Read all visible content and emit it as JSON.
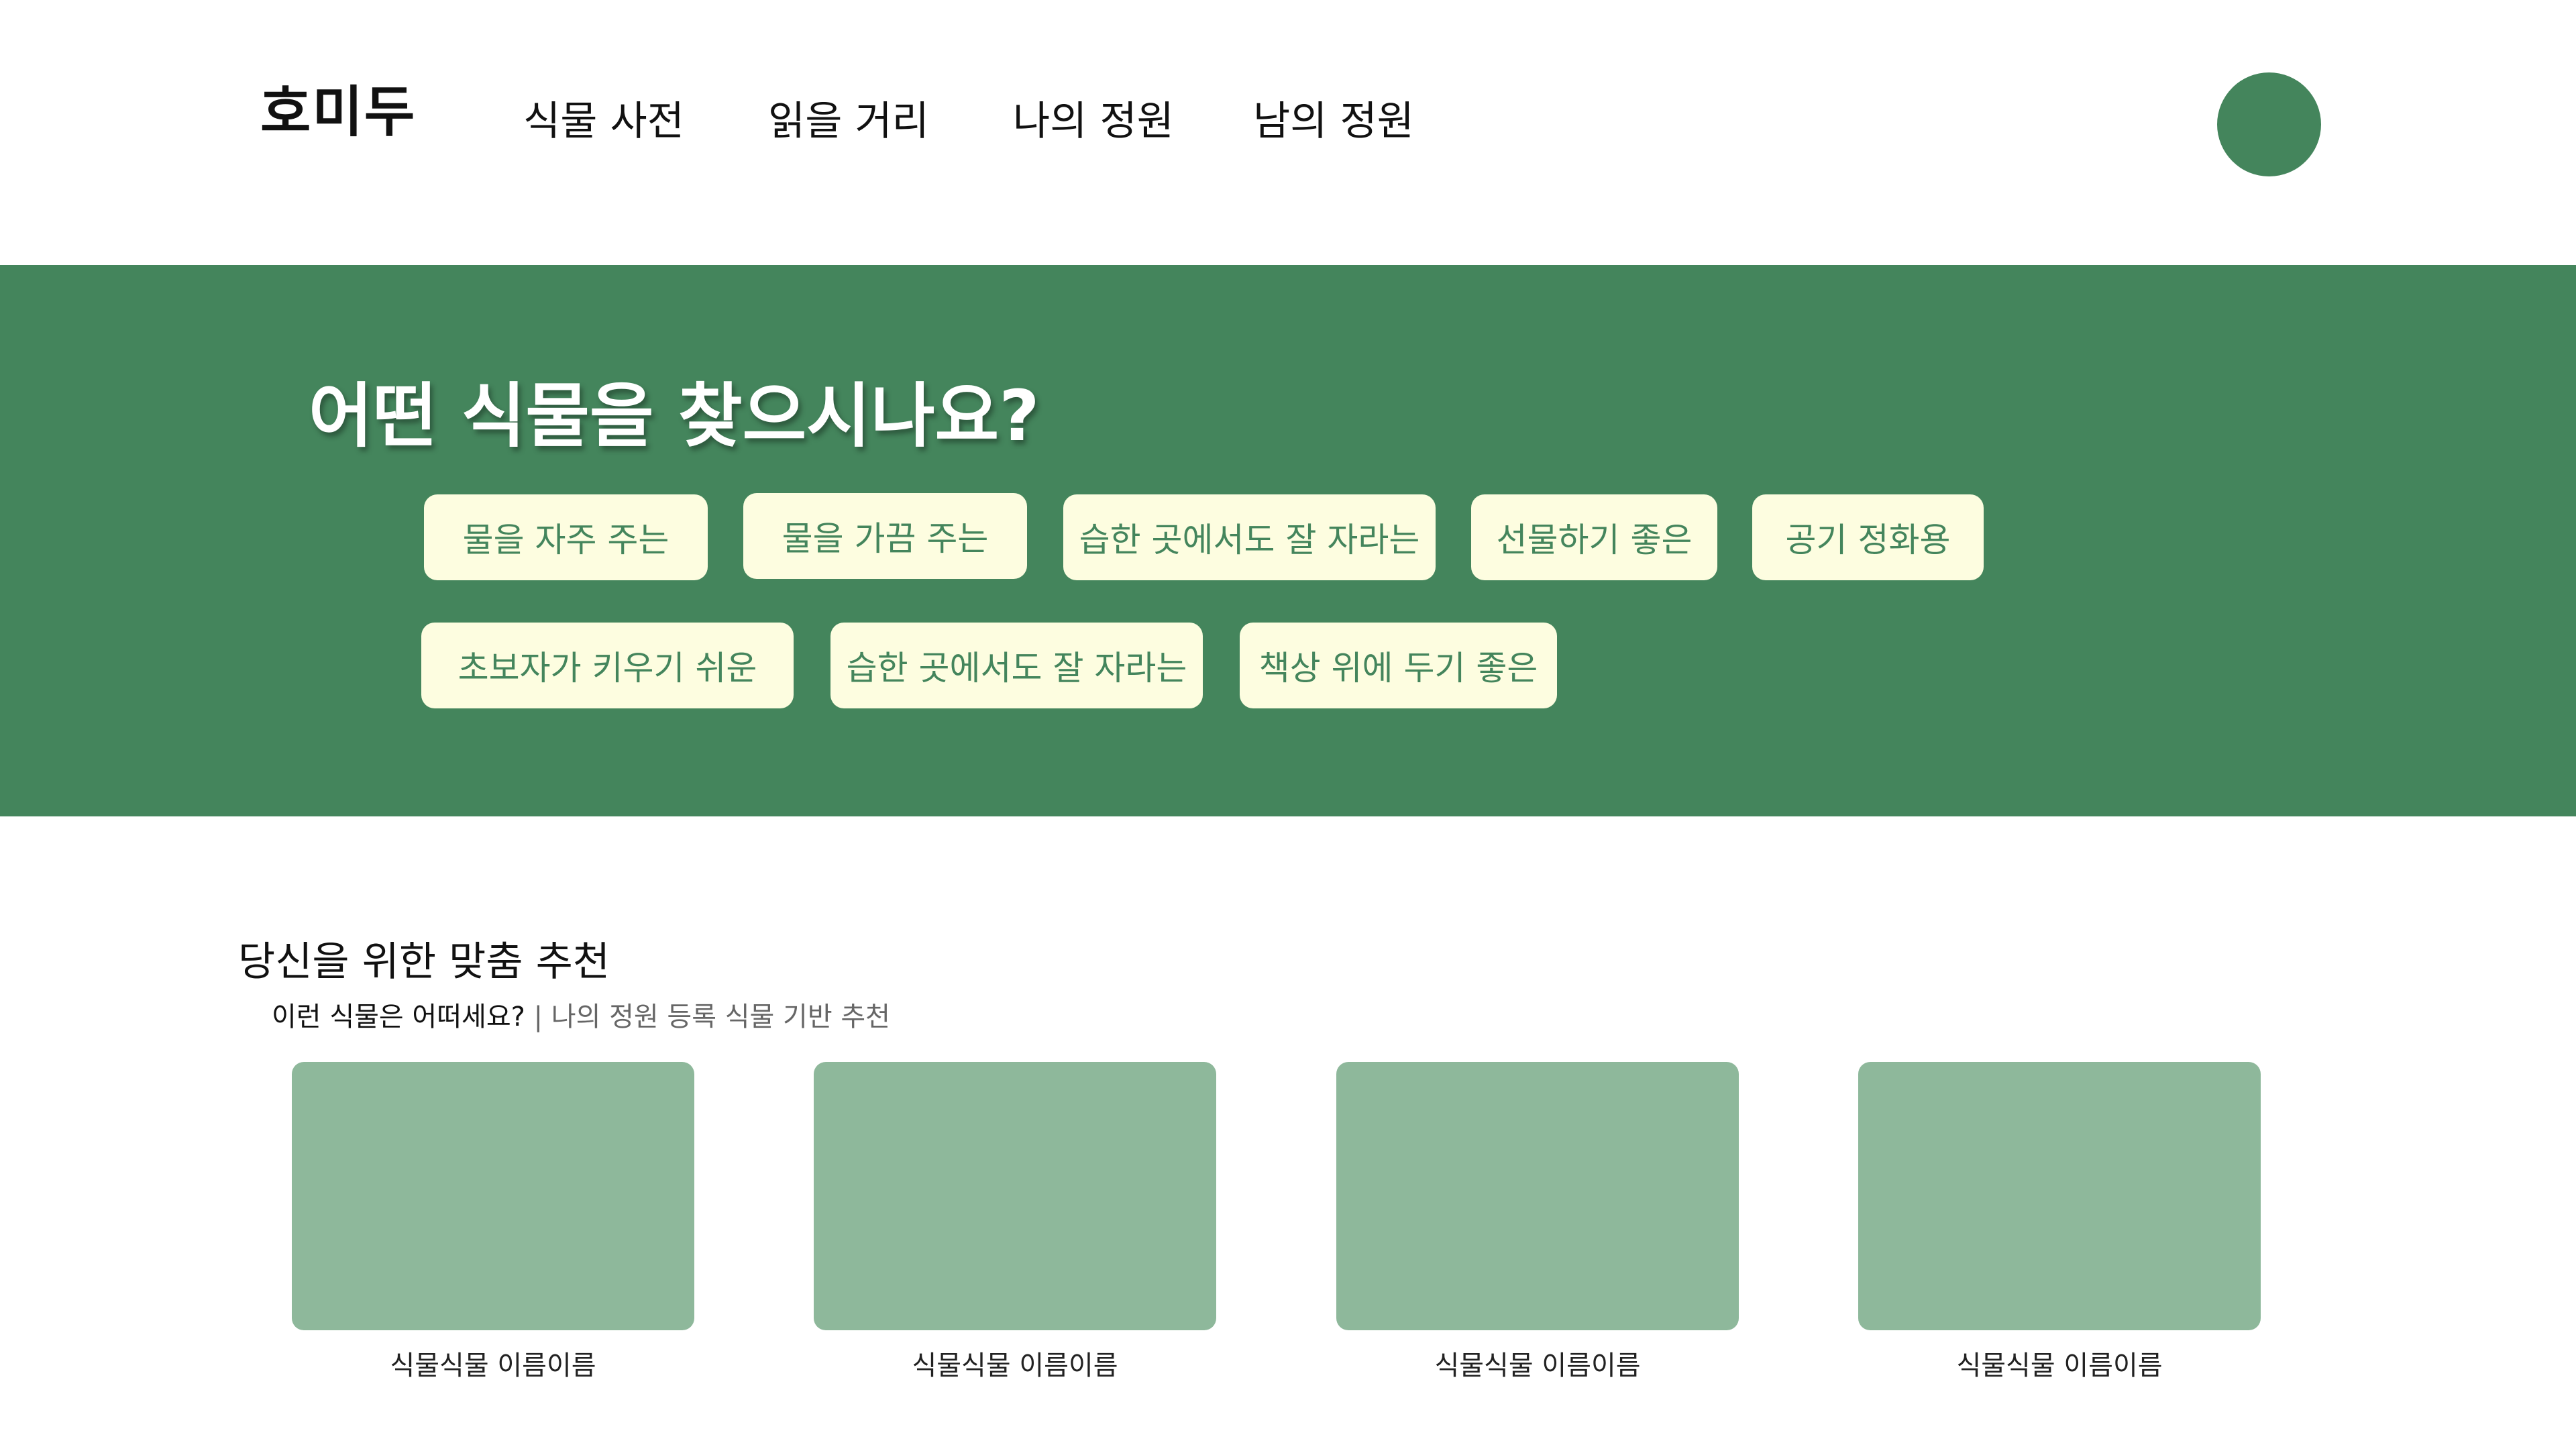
{
  "header": {
    "logo": "호미두",
    "nav": [
      "식물 사전",
      "읽을 거리",
      "나의 정원",
      "남의 정원"
    ]
  },
  "hero": {
    "title": "어떤 식물을 찾으시나요?",
    "chips_row1": [
      "물을 자주 주는",
      "물을 가끔 주는",
      "습한 곳에서도 잘 자라는",
      "선물하기 좋은",
      "공기 정화용"
    ],
    "chips_row2": [
      "초보자가 키우기 쉬운",
      "습한 곳에서도 잘 자라는",
      "책상 위에 두기 좋은"
    ]
  },
  "recommend": {
    "title": "당신을 위한 맞춤 추천",
    "question": "이런 식물은 어떠세요?",
    "description": " | 나의 정원 등록 식물 기반 추천",
    "cards": [
      "식물식물 이름이름",
      "식물식물 이름이름",
      "식물식물 이름이름",
      "식물식물 이름이름"
    ]
  },
  "colors": {
    "brand_green": "#44855c",
    "chip_bg": "#fdfde0",
    "card_placeholder": "#8eb89b"
  }
}
